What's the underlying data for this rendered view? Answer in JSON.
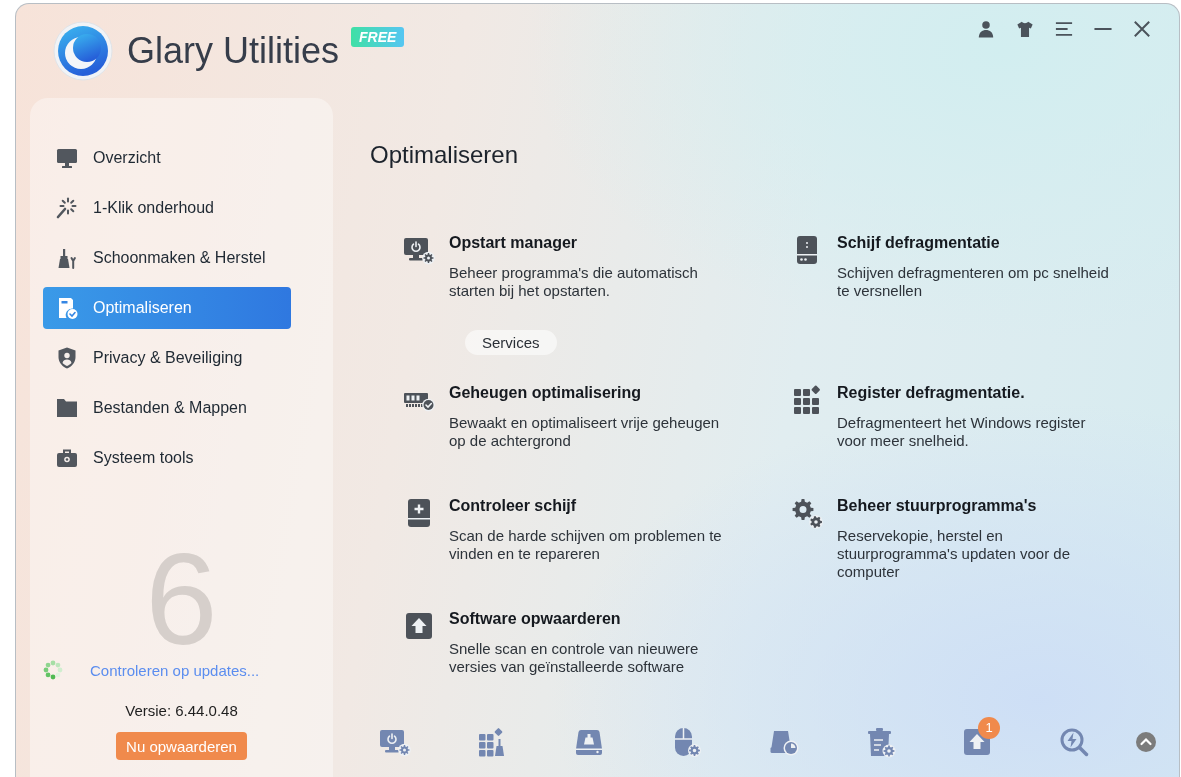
{
  "app": {
    "name": "Glary Utilities",
    "edition": "FREE"
  },
  "sidebar": {
    "items": [
      {
        "label": "Overzicht",
        "selected": false
      },
      {
        "label": "1-Klik onderhoud",
        "selected": false
      },
      {
        "label": "Schoonmaken & Herstel",
        "selected": false
      },
      {
        "label": "Optimaliseren",
        "selected": true
      },
      {
        "label": "Privacy & Beveiliging",
        "selected": false
      },
      {
        "label": "Bestanden & Mappen",
        "selected": false
      },
      {
        "label": "Systeem tools",
        "selected": false
      }
    ],
    "background_digit": "6",
    "update_status": "Controleren op updates...",
    "version": "Versie: 6.44.0.48",
    "upgrade_button": "Nu opwaarderen"
  },
  "main": {
    "title": "Optimaliseren",
    "features": [
      {
        "title": "Opstart manager",
        "description": "Beheer programma's die automatisch\nstarten bij het opstarten.",
        "button": "Services"
      },
      {
        "title": "Schijf defragmentatie",
        "description": "Schijven defragmenteren om pc snelheid\nte versnellen"
      },
      {
        "title": "Geheugen optimalisering",
        "description": "Bewaakt en optimaliseert vrije geheugen\nop de achtergrond"
      },
      {
        "title": "Register defragmentatie.",
        "description": "Defragmenteert het Windows register\nvoor meer snelheid."
      },
      {
        "title": "Controleer schijf",
        "description": "Scan de harde schijven om problemen te\nvinden en te repareren"
      },
      {
        "title": "Beheer stuurprogramma's",
        "description": "Reservekopie, herstel en\nstuurprogramma's updaten voor de\ncomputer"
      },
      {
        "title": "Software opwaarderen",
        "description": "Snelle scan en controle van nieuwere\nversies van geïnstalleerde software"
      }
    ]
  },
  "toolbar": [
    {
      "kind": "tool"
    },
    {
      "kind": "tool"
    },
    {
      "kind": "tool"
    },
    {
      "kind": "tool"
    },
    {
      "kind": "tool"
    },
    {
      "kind": "tool"
    },
    {
      "kind": "tool",
      "badge": "1"
    },
    {
      "kind": "tool"
    },
    {
      "kind": "collapse"
    }
  ]
}
